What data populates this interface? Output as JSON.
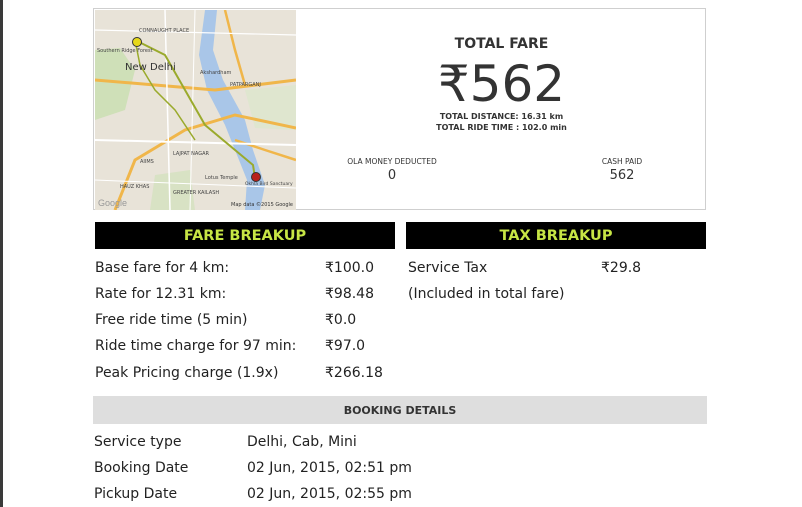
{
  "map": {
    "labels": {
      "connaught_place": "CONNAUGHT PLACE",
      "new_delhi": "New Delhi",
      "southern_ridge": "Southern Ridge Forest",
      "patparganj": "PATPARGANJ",
      "lajpat_nagar": "LAJPAT NAGAR",
      "aiims": "AIIMS",
      "hauz_khas": "HAUZ KHAS",
      "greater_kailash": "GREATER KAILASH",
      "lotus_temple": "Lotus Temple",
      "akshardham": "Akshardham",
      "sanctuary": "Okhla Bird Sanctuary"
    },
    "credit": "Map data ©2015 Google",
    "logo": "Google",
    "route_color": "#9aaa2c",
    "start_pin_color": "#e6d819",
    "end_pin_color": "#b8201b"
  },
  "summary": {
    "total_fare_label": "TOTAL FARE",
    "total_fare_value": "₹562",
    "total_distance": "TOTAL DISTANCE: 16.31 km",
    "total_ride_time": "TOTAL RIDE TIME : 102.0 min",
    "ola_money_label": "OLA MONEY DEDUCTED",
    "ola_money_value": "0",
    "cash_paid_label": "CASH PAID",
    "cash_paid_value": "562"
  },
  "fare_breakup": {
    "title": "FARE BREAKUP",
    "rows": [
      {
        "label": "Base fare for 4 km:",
        "value": "₹100.0"
      },
      {
        "label": "Rate for 12.31 km:",
        "value": "₹98.48"
      },
      {
        "label": "Free ride time (5 min)",
        "value": "₹0.0"
      },
      {
        "label": "Ride time charge for 97 min:",
        "value": "₹97.0"
      },
      {
        "label": "Peak Pricing charge (1.9x)",
        "value": "₹266.18"
      }
    ]
  },
  "tax_breakup": {
    "title": "TAX BREAKUP",
    "rows": [
      {
        "label": "Service Tax",
        "value": "₹29.8"
      },
      {
        "label": "(Included in total fare)",
        "value": ""
      }
    ]
  },
  "booking_details": {
    "title": "BOOKING DETAILS",
    "rows": [
      {
        "label": "Service type",
        "value": "Delhi, Cab, Mini"
      },
      {
        "label": "Booking Date",
        "value": "02 Jun, 2015, 02:51 pm"
      },
      {
        "label": "Pickup Date",
        "value": "02 Jun, 2015, 02:55 pm"
      }
    ]
  },
  "colors": {
    "header_bg": "#000000",
    "header_text": "#c7e545",
    "booking_bar_bg": "#dedede"
  }
}
